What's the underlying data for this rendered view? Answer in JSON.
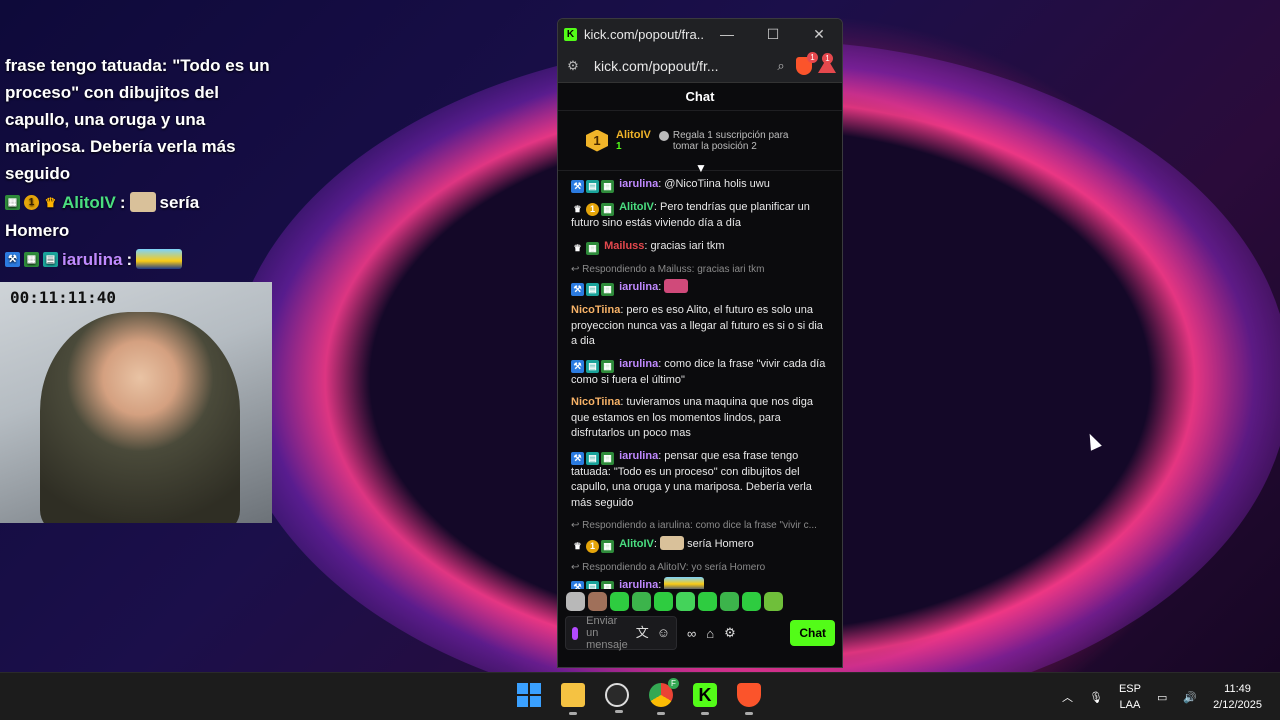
{
  "overlay": {
    "text_lines": [
      "frase tengo tatuada: \"Todo es un",
      "proceso\" con dibujitos del",
      "capullo, una oruga y una",
      "mariposa. Debería verla más",
      "seguido"
    ],
    "row1_user": "AlitoIV",
    "row1_sep": ":",
    "row1_msg": "sería",
    "row1_msg2": "Homero",
    "row2_user": "iarulina",
    "row2_sep": ":",
    "badge_gold_num": "1"
  },
  "webcam": {
    "timer": "00:11:11:40"
  },
  "window": {
    "title": "kick.com/popout/fra...",
    "url": "kick.com/popout/fr...",
    "brave_badge": "1",
    "alert_badge": "1",
    "minimize": "—",
    "maximize": "☐",
    "close": "✕"
  },
  "chat": {
    "header": "Chat",
    "pinned": {
      "rank": "1",
      "user": "AlitoIV",
      "count": "1",
      "gift_text": "Regala 1 suscripción para tomar la posición 2"
    },
    "messages": [
      {
        "user": "iarulina",
        "text": ": @NicoTiina holis uwu"
      },
      {
        "user": "AlitoIV",
        "text": ": Pero tendrías que planificar un futuro sino estás viviendo día a día"
      },
      {
        "user": "Mailuss",
        "text": ": gracias iari tkm"
      },
      {
        "reply": "Respondiendo a Mailuss: gracias iari tkm",
        "user": "iarulina",
        "text": ":"
      },
      {
        "user": "NicoTiina",
        "text": ": pero es eso Alito, el futuro es solo una proyeccion nunca vas a llegar al futuro es si o si dia a dia"
      },
      {
        "user": "iarulina",
        "text": ": como dice la frase \"vivir cada día como si fuera el último\""
      },
      {
        "user": "NicoTiina",
        "text": ": tuvieramos una maquina que nos diga que estamos en los momentos lindos, para disfrutarlos un poco mas"
      },
      {
        "user": "iarulina",
        "text": ": pensar que esa frase tengo tatuada: \"Todo es un proceso\" con dibujitos del capullo, una oruga y una mariposa. Debería verla más seguido"
      },
      {
        "reply": "Respondiendo a iarulina: como dice la frase \"vivir c...",
        "user": "AlitoIV",
        "text": "sería Homero"
      },
      {
        "reply": "Respondiendo a AlitoIV: yo sería Homero",
        "user": "iarulina",
        "text": ":"
      }
    ],
    "input_placeholder": "Enviar un mensaje",
    "send_label": "Chat",
    "badge_gold_num": "1"
  },
  "taskbar": {
    "lang1": "ESP",
    "lang2": "LAA",
    "time": "11:49",
    "date": "2/12/2025",
    "chrome_badge": "F"
  },
  "colors": {
    "kick_green": "#53fc18",
    "user_purple": "#c08aff",
    "user_green": "#4ade80",
    "user_red": "#e5484d",
    "user_orange": "#f7b267"
  }
}
